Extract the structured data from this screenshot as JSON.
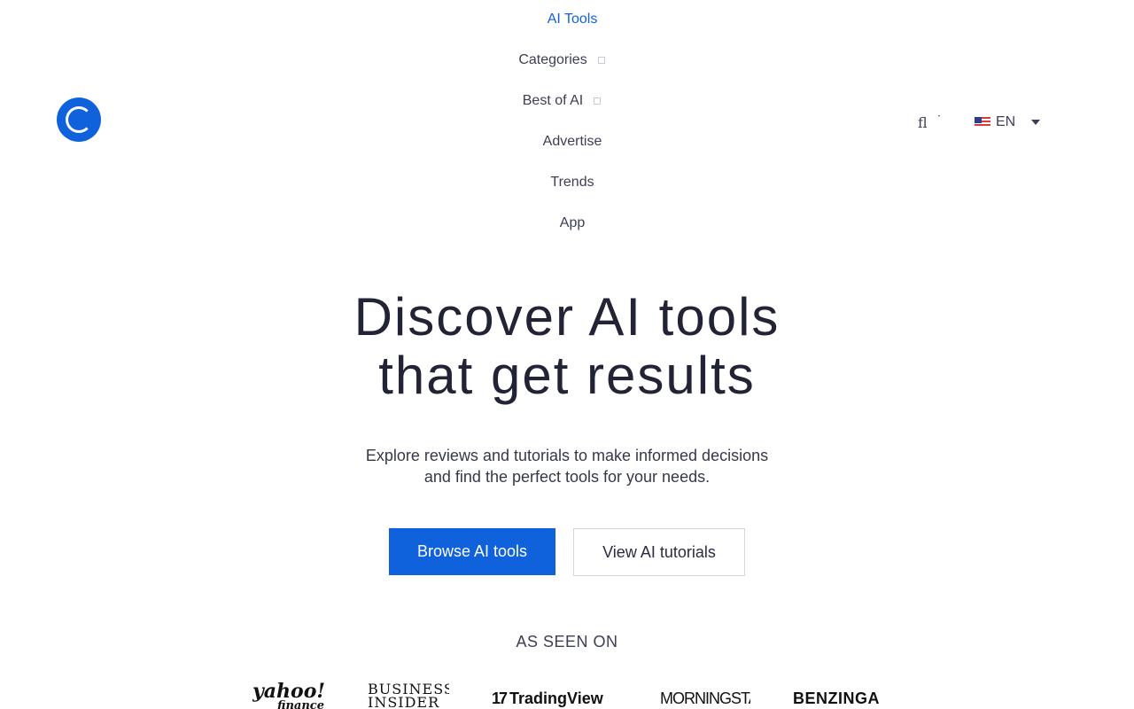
{
  "header": {
    "logo_icon": "circle-c-logo-icon",
    "accent_color": "#1062dc",
    "nav": [
      {
        "label": "AI Tools",
        "active": true,
        "has_dropdown": false
      },
      {
        "label": "Categories",
        "active": false,
        "has_dropdown": true
      },
      {
        "label": "Best of AI",
        "active": false,
        "has_dropdown": true
      },
      {
        "label": "Advertise",
        "active": false,
        "has_dropdown": false
      },
      {
        "label": "Trends",
        "active": false,
        "has_dropdown": false
      },
      {
        "label": "App",
        "active": false,
        "has_dropdown": false
      }
    ],
    "search_icon": "search-icon",
    "search_glyph": "fl",
    "language": {
      "code": "EN",
      "flag": "us-flag-icon"
    }
  },
  "hero": {
    "title_line1": "Discover AI tools",
    "title_line2": "that get results",
    "subtitle_line1": "Explore reviews and tutorials to make informed decisions",
    "subtitle_line2": "and find the perfect tools for your needs.",
    "primary_cta": "Browse AI tools",
    "secondary_cta": "View AI tutorials"
  },
  "press": {
    "heading": "AS SEEN ON",
    "logos": [
      {
        "name": "yahoo!",
        "sub": "finance"
      },
      {
        "name": "BUSINESS",
        "sub": "INSIDER"
      },
      {
        "mark": "17",
        "name": "TradingView"
      },
      {
        "name": "MORNINGSTAR"
      },
      {
        "name": "BENZINGA"
      }
    ]
  }
}
